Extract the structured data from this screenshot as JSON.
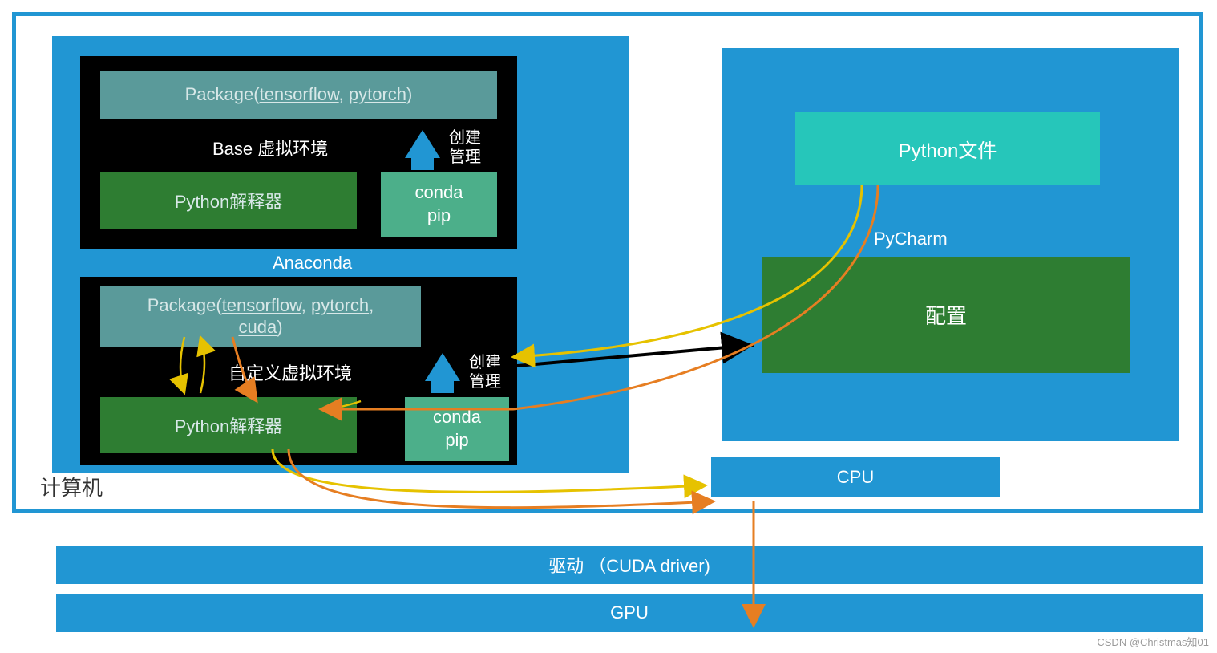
{
  "computer": {
    "label": "计算机",
    "anaconda": {
      "label": "Anaconda",
      "env_base": {
        "package_label": "Package(tensorflow, pytorch)",
        "env_label": "Base 虚拟环境",
        "interpreter": "Python解释器",
        "conda": "conda\npip",
        "create_label": "创建\n管理"
      },
      "env_custom": {
        "package_label": "Package(tensorflow, pytorch,\ncuda)",
        "env_label": "自定义虚拟环境",
        "interpreter": "Python解释器",
        "conda": "conda\npip",
        "create_label": "创建\n管理"
      }
    },
    "pycharm": {
      "file_label": "Python文件",
      "pycharm_label": "PyCharm",
      "config_label": "配置"
    },
    "cpu_label": "CPU"
  },
  "driver_label": "驱动 （CUDA driver)",
  "gpu_label": "GPU",
  "watermark": "CSDN @Christmas知01"
}
